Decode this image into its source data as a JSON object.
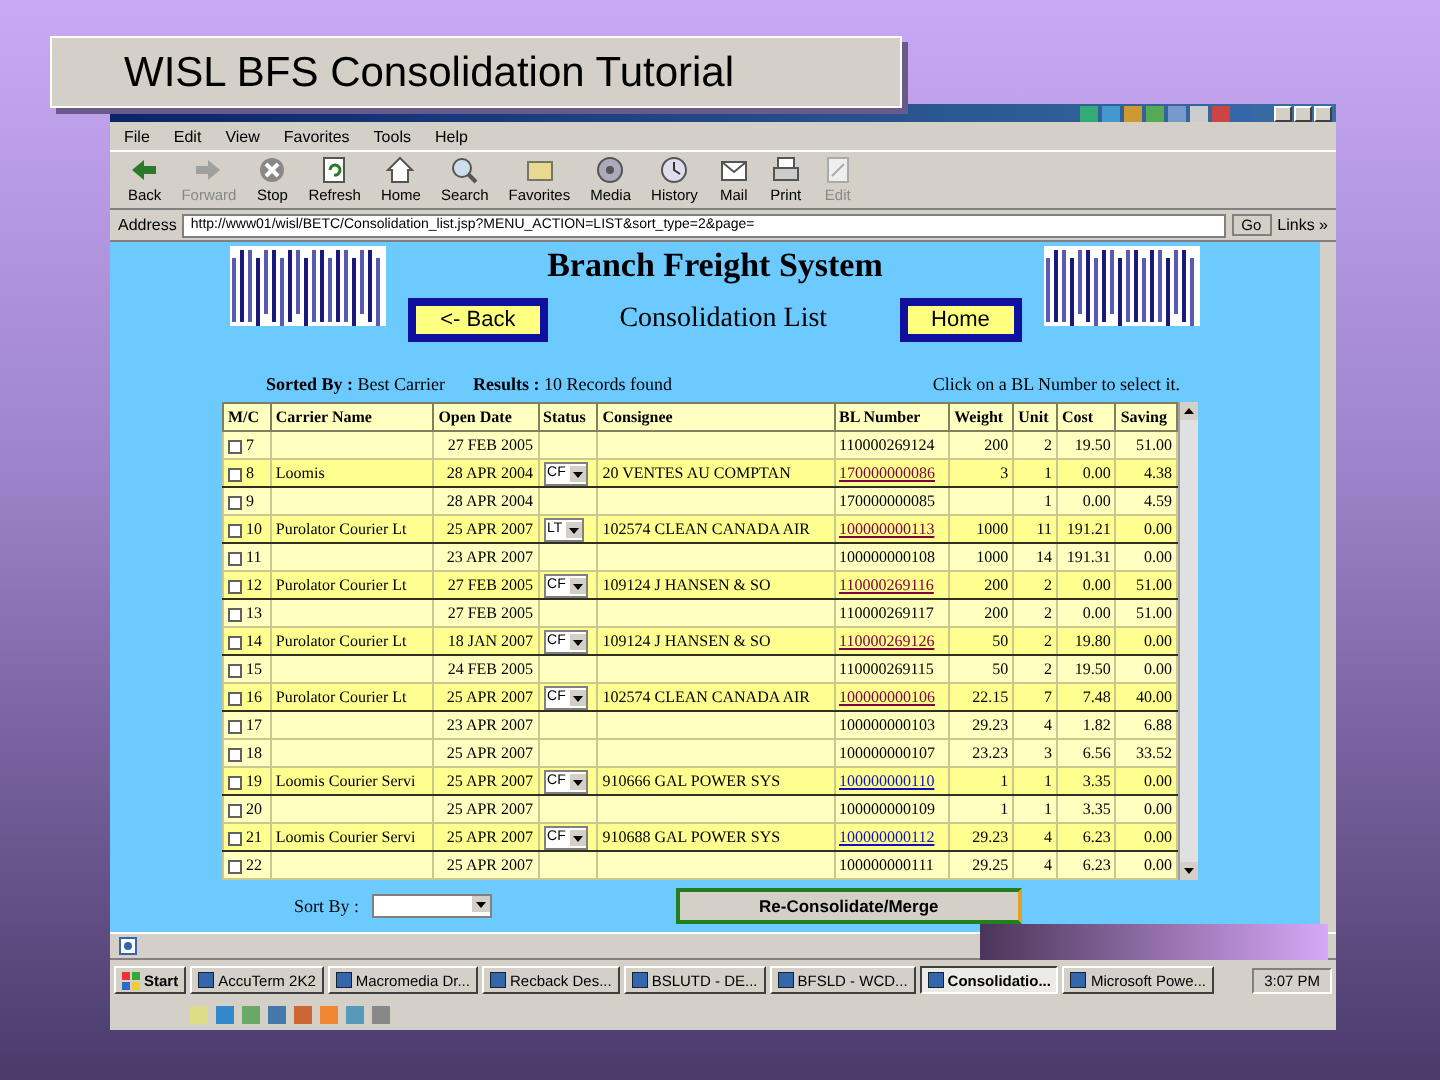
{
  "slide": {
    "title": "WISL BFS Consolidation Tutorial"
  },
  "browser": {
    "menu": [
      "File",
      "Edit",
      "View",
      "Favorites",
      "Tools",
      "Help"
    ],
    "toolbar": [
      {
        "label": "Back",
        "kind": "back",
        "disabled": false
      },
      {
        "label": "Forward",
        "kind": "forward",
        "disabled": true
      },
      {
        "label": "Stop",
        "kind": "stop",
        "disabled": false
      },
      {
        "label": "Refresh",
        "kind": "refresh",
        "disabled": false
      },
      {
        "label": "Home",
        "kind": "home",
        "disabled": false
      },
      {
        "label": "Search",
        "kind": "search",
        "disabled": false
      },
      {
        "label": "Favorites",
        "kind": "favorites",
        "disabled": false
      },
      {
        "label": "Media",
        "kind": "media",
        "disabled": false
      },
      {
        "label": "History",
        "kind": "history",
        "disabled": false
      },
      {
        "label": "Mail",
        "kind": "mail",
        "disabled": false
      },
      {
        "label": "Print",
        "kind": "print",
        "disabled": false
      },
      {
        "label": "Edit",
        "kind": "edit",
        "disabled": true
      }
    ],
    "address_label": "Address",
    "url": "http://www01/wisl/BETC/Consolidation_list.jsp?MENU_ACTION=LIST&sort_type=2&page=",
    "go": "Go",
    "links": "Links »"
  },
  "page": {
    "title": "Branch Freight System",
    "subtitle": "Consolidation List",
    "back_button": "<- Back",
    "home_button": "Home",
    "sorted_by": "**Sorted By :** Best Carrier",
    "results": "**Results :** 10 Records found",
    "hint": "Click on a BL Number to select it.",
    "columns": [
      "M/C",
      "Carrier Name",
      "Open Date",
      "Status",
      "Consignee",
      "BL Number",
      "Weight",
      "Unit",
      "Cost",
      "Saving"
    ],
    "rows": [
      {
        "kind": "member",
        "number": "7",
        "checked": false,
        "open_date": "27 FEB 2005",
        "bl_number": "110000269124",
        "weight": "200",
        "unit": "2",
        "cost": "19.50",
        "saving": "51.00"
      },
      {
        "kind": "master",
        "number": "8",
        "checked": false,
        "carrier": "Loomis",
        "open_date": "28 APR 2004",
        "status": "CF",
        "consignee": "20 VENTES AU COMPTAN",
        "bl_number": "170000000086",
        "visited": true,
        "weight": "3",
        "unit": "1",
        "cost": "0.00",
        "saving": "4.38"
      },
      {
        "kind": "member",
        "number": "9",
        "checked": false,
        "open_date": "28 APR 2004",
        "bl_number": "170000000085",
        "unit": "1",
        "cost": "0.00",
        "saving": "4.59"
      },
      {
        "kind": "master",
        "number": "10",
        "checked": false,
        "carrier": "Purolator Courier Lt",
        "open_date": "25 APR 2007",
        "status": "LT",
        "consignee": "102574 CLEAN CANADA AIR",
        "bl_number": "100000000113",
        "visited": true,
        "weight": "1000",
        "unit": "11",
        "cost": "191.21",
        "saving": "0.00"
      },
      {
        "kind": "member",
        "number": "11",
        "checked": false,
        "open_date": "23 APR 2007",
        "bl_number": "100000000108",
        "weight": "1000",
        "unit": "14",
        "cost": "191.31",
        "saving": "0.00"
      },
      {
        "kind": "master",
        "number": "12",
        "checked": false,
        "carrier": "Purolator Courier Lt",
        "open_date": "27 FEB 2005",
        "status": "CF",
        "consignee": "109124 J HANSEN & SO",
        "bl_number": "110000269116",
        "visited": true,
        "weight": "200",
        "unit": "2",
        "cost": "0.00",
        "saving": "51.00"
      },
      {
        "kind": "member",
        "number": "13",
        "checked": false,
        "open_date": "27 FEB 2005",
        "bl_number": "110000269117",
        "weight": "200",
        "unit": "2",
        "cost": "0.00",
        "saving": "51.00"
      },
      {
        "kind": "master",
        "number": "14",
        "checked": false,
        "carrier": "Purolator Courier Lt",
        "open_date": "18 JAN 2007",
        "status": "CF",
        "consignee": "109124 J HANSEN & SO",
        "bl_number": "110000269126",
        "visited": true,
        "weight": "50",
        "unit": "2",
        "cost": "19.80",
        "saving": "0.00"
      },
      {
        "kind": "member",
        "number": "15",
        "checked": false,
        "open_date": "24 FEB 2005",
        "bl_number": "110000269115",
        "weight": "50",
        "unit": "2",
        "cost": "19.50",
        "saving": "0.00"
      },
      {
        "kind": "master",
        "number": "16",
        "checked": false,
        "carrier": "Purolator Courier Lt",
        "open_date": "25 APR 2007",
        "status": "CF",
        "consignee": "102574 CLEAN CANADA AIR",
        "bl_number": "100000000106",
        "visited": true,
        "weight": "22.15",
        "unit": "7",
        "cost": "7.48",
        "saving": "40.00"
      },
      {
        "kind": "member",
        "number": "17",
        "checked": false,
        "open_date": "23 APR 2007",
        "bl_number": "100000000103",
        "weight": "29.23",
        "unit": "4",
        "cost": "1.82",
        "saving": "6.88"
      },
      {
        "kind": "member",
        "number": "18",
        "checked": false,
        "open_date": "25 APR 2007",
        "bl_number": "100000000107",
        "weight": "23.23",
        "unit": "3",
        "cost": "6.56",
        "saving": "33.52"
      },
      {
        "kind": "master",
        "number": "19",
        "checked": false,
        "carrier": "Loomis Courier Servi",
        "open_date": "25 APR 2007",
        "status": "CF",
        "consignee": "910666 GAL POWER SYS",
        "bl_number": "100000000110",
        "visited": false,
        "weight": "1",
        "unit": "1",
        "cost": "3.35",
        "saving": "0.00"
      },
      {
        "kind": "member",
        "number": "20",
        "checked": false,
        "open_date": "25 APR 2007",
        "bl_number": "100000000109",
        "weight": "1",
        "unit": "1",
        "cost": "3.35",
        "saving": "0.00"
      },
      {
        "kind": "master",
        "number": "21",
        "checked": false,
        "carrier": "Loomis Courier Servi",
        "open_date": "25 APR 2007",
        "status": "CF",
        "consignee": "910688 GAL POWER SYS",
        "bl_number": "100000000112",
        "visited": false,
        "weight": "29.23",
        "unit": "4",
        "cost": "6.23",
        "saving": "0.00"
      },
      {
        "kind": "member",
        "number": "22",
        "checked": false,
        "open_date": "25 APR 2007",
        "bl_number": "100000000111",
        "weight": "29.25",
        "unit": "4",
        "cost": "6.23",
        "saving": "0.00"
      }
    ],
    "sort_label": "Sort By :",
    "merge_button": "Re-Consolidate/Merge"
  },
  "taskbar": {
    "start": "Start",
    "items": [
      {
        "label": "AccuTerm 2K2",
        "selected": false
      },
      {
        "label": "Macromedia Dr...",
        "selected": false
      },
      {
        "label": "Recback Des...",
        "selected": false
      },
      {
        "label": "BSLUTD - DE...",
        "selected": false
      },
      {
        "label": "BFSLD - WCD...",
        "selected": false
      },
      {
        "label": "Consolidatio...",
        "selected": true
      },
      {
        "label": "Microsoft Powe...",
        "selected": false
      }
    ],
    "clock": "3:07 PM"
  }
}
